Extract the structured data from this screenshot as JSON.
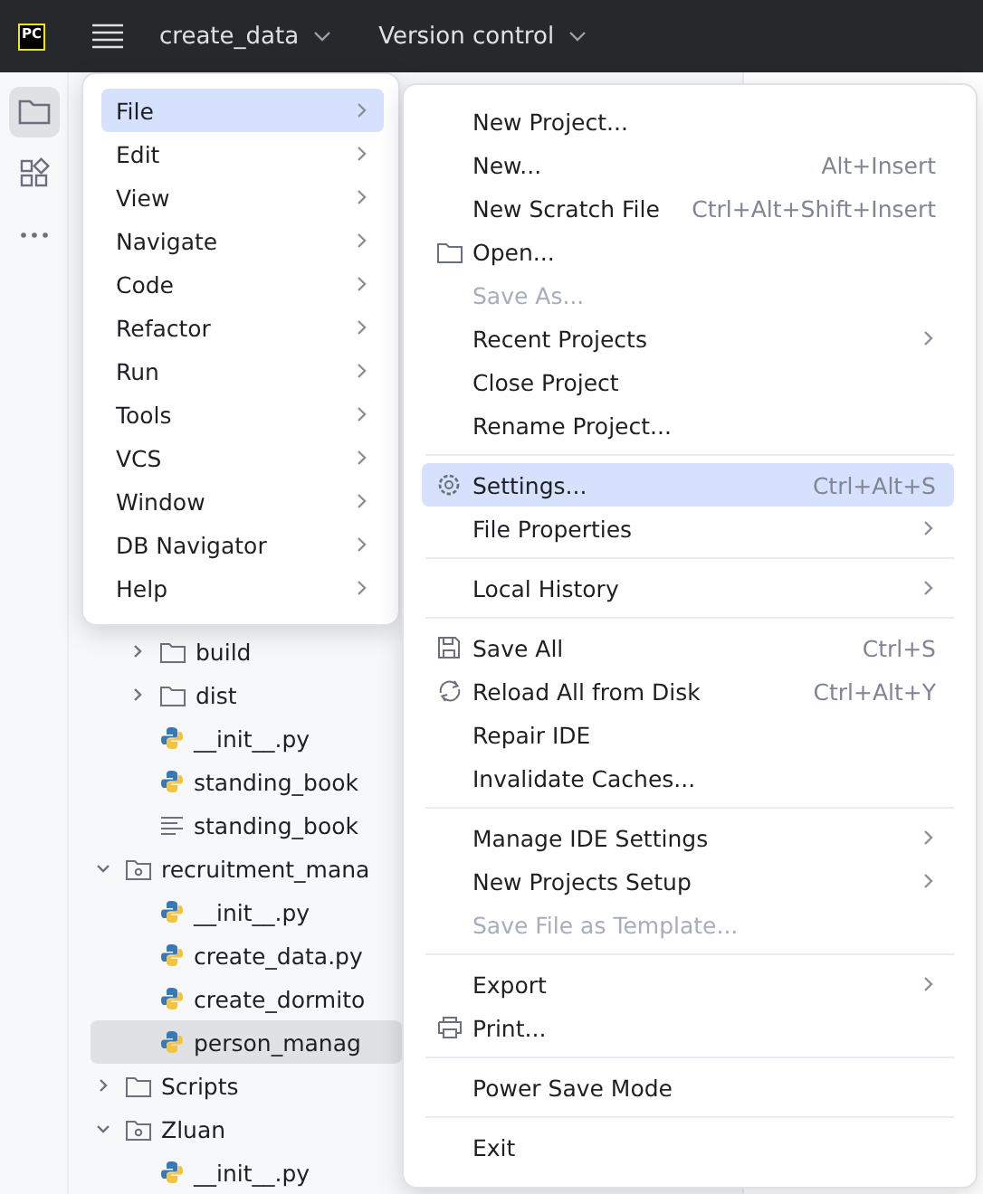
{
  "title_bar": {
    "logo": "PC",
    "project": "create_data",
    "vcs": "Version control"
  },
  "tool_strip": [
    {
      "kind": "folder",
      "selected": true
    },
    {
      "kind": "blocks",
      "selected": false
    },
    {
      "kind": "more",
      "selected": false
    }
  ],
  "tree": [
    {
      "children": [
        {
          "label": "build",
          "kind": "folder",
          "expanded": false,
          "selected": false
        },
        {
          "label": "dist",
          "kind": "folder",
          "expanded": false,
          "selected": false
        },
        {
          "label": "__init__.py",
          "kind": "python",
          "selected": false
        },
        {
          "label": "standing_book",
          "kind": "python",
          "selected": false
        },
        {
          "label": "standing_book",
          "kind": "text",
          "selected": false
        }
      ]
    },
    {
      "label": "recruitment_mana",
      "kind": "module",
      "expanded": true,
      "selected": false,
      "children": [
        {
          "label": "__init__.py",
          "kind": "python",
          "selected": false
        },
        {
          "label": "create_data.py",
          "kind": "python",
          "selected": false
        },
        {
          "label": "create_dormito",
          "kind": "python",
          "selected": false
        },
        {
          "label": "person_manag",
          "kind": "python",
          "selected": true
        }
      ]
    },
    {
      "label": "Scripts",
      "kind": "folder",
      "expanded": false,
      "selected": false
    },
    {
      "label": "Zluan",
      "kind": "module",
      "expanded": true,
      "selected": false,
      "children": [
        {
          "label": "__init__.py",
          "kind": "python",
          "selected": false
        }
      ]
    }
  ],
  "main_menu": [
    {
      "label": "File",
      "selected": true
    },
    {
      "label": "Edit",
      "selected": false
    },
    {
      "label": "View",
      "selected": false
    },
    {
      "label": "Navigate",
      "selected": false
    },
    {
      "label": "Code",
      "selected": false
    },
    {
      "label": "Refactor",
      "selected": false
    },
    {
      "label": "Run",
      "selected": false
    },
    {
      "label": "Tools",
      "selected": false
    },
    {
      "label": "VCS",
      "selected": false
    },
    {
      "label": "Window",
      "selected": false
    },
    {
      "label": "DB Navigator",
      "selected": false
    },
    {
      "label": "Help",
      "selected": false
    }
  ],
  "file_menu": [
    [
      {
        "label": "New Project...",
        "disabled": false,
        "selected": false,
        "submenu": false
      },
      {
        "label": "New...",
        "shortcut": "Alt+Insert",
        "disabled": false,
        "selected": false,
        "submenu": false
      },
      {
        "label": "New Scratch File",
        "shortcut": "Ctrl+Alt+Shift+Insert",
        "disabled": false,
        "selected": false,
        "submenu": false
      },
      {
        "label": "Open...",
        "kind": "folder",
        "disabled": false,
        "selected": false,
        "submenu": false
      },
      {
        "label": "Save As...",
        "disabled": true,
        "selected": false,
        "submenu": false
      },
      {
        "label": "Recent Projects",
        "disabled": false,
        "selected": false,
        "submenu": true
      },
      {
        "label": "Close Project",
        "disabled": false,
        "selected": false,
        "submenu": false
      },
      {
        "label": "Rename Project...",
        "disabled": false,
        "selected": false,
        "submenu": false
      }
    ],
    [
      {
        "label": "Settings...",
        "kind": "gear",
        "shortcut": "Ctrl+Alt+S",
        "disabled": false,
        "selected": true,
        "submenu": false
      },
      {
        "label": "File Properties",
        "disabled": false,
        "selected": false,
        "submenu": true
      }
    ],
    [
      {
        "label": "Local History",
        "disabled": false,
        "selected": false,
        "submenu": true
      }
    ],
    [
      {
        "label": "Save All",
        "kind": "save",
        "shortcut": "Ctrl+S",
        "disabled": false,
        "selected": false,
        "submenu": false
      },
      {
        "label": "Reload All from Disk",
        "kind": "reload",
        "shortcut": "Ctrl+Alt+Y",
        "disabled": false,
        "selected": false,
        "submenu": false
      },
      {
        "label": "Repair IDE",
        "disabled": false,
        "selected": false,
        "submenu": false
      },
      {
        "label": "Invalidate Caches...",
        "disabled": false,
        "selected": false,
        "submenu": false
      }
    ],
    [
      {
        "label": "Manage IDE Settings",
        "disabled": false,
        "selected": false,
        "submenu": true
      },
      {
        "label": "New Projects Setup",
        "disabled": false,
        "selected": false,
        "submenu": true
      },
      {
        "label": "Save File as Template...",
        "disabled": true,
        "selected": false,
        "submenu": false
      }
    ],
    [
      {
        "label": "Export",
        "disabled": false,
        "selected": false,
        "submenu": true
      },
      {
        "label": "Print...",
        "kind": "print",
        "disabled": false,
        "selected": false,
        "submenu": false
      }
    ],
    [
      {
        "label": "Power Save Mode",
        "disabled": false,
        "selected": false,
        "submenu": false
      }
    ],
    [
      {
        "label": "Exit",
        "disabled": false,
        "selected": false,
        "submenu": false
      }
    ]
  ]
}
